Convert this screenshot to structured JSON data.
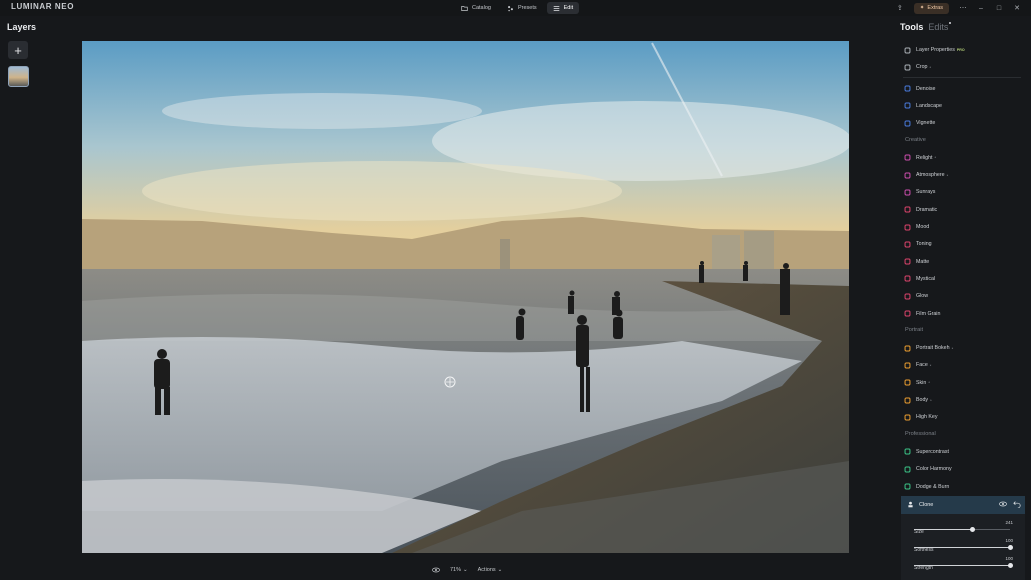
{
  "app": {
    "title": "LUMINAR NEO"
  },
  "modes": [
    {
      "label": "Catalog",
      "icon": "folder-icon"
    },
    {
      "label": "Presets",
      "icon": "presets-icon"
    },
    {
      "label": "Edit",
      "icon": "sliders-icon"
    }
  ],
  "top_right": {
    "extras_label": "Extras"
  },
  "layers": {
    "title": "Layers",
    "add": "+"
  },
  "bottom": {
    "zoom": "71%",
    "actions": "Actions"
  },
  "panel": {
    "tab_tools": "Tools",
    "tab_edits": "Edits",
    "essentials": [
      {
        "label": "Layer Properties",
        "badge": "PRO",
        "icon": "layers-icon",
        "color": "#aeb3ba"
      },
      {
        "label": "Crop",
        "badge": "*",
        "icon": "crop-icon",
        "color": "#aeb3ba"
      },
      {
        "label": "Denoise",
        "icon": "denoise-icon",
        "color": "#4a7de0"
      },
      {
        "label": "Landscape",
        "icon": "landscape-icon",
        "color": "#4a7de0"
      },
      {
        "label": "Vignette",
        "icon": "vignette-icon",
        "color": "#4a7de0"
      }
    ],
    "creative_title": "Creative",
    "creative": [
      {
        "label": "Relight",
        "badge": "*",
        "icon": "relight-icon",
        "color": "#d04fb0"
      },
      {
        "label": "Atmosphere",
        "badge": "*",
        "icon": "atmosphere-icon",
        "color": "#d04fb0"
      },
      {
        "label": "Sunrays",
        "icon": "sunrays-icon",
        "color": "#d04fb0"
      },
      {
        "label": "Dramatic",
        "icon": "dramatic-icon",
        "color": "#e0456e"
      },
      {
        "label": "Mood",
        "icon": "mood-icon",
        "color": "#e0456e"
      },
      {
        "label": "Toning",
        "icon": "toning-icon",
        "color": "#e0456e"
      },
      {
        "label": "Matte",
        "icon": "matte-icon",
        "color": "#e0456e"
      },
      {
        "label": "Mystical",
        "icon": "mystical-icon",
        "color": "#e0456e"
      },
      {
        "label": "Glow",
        "icon": "glow-icon",
        "color": "#e0456e"
      },
      {
        "label": "Film Grain",
        "icon": "film-grain-icon",
        "color": "#e0456e"
      }
    ],
    "portrait_title": "Portrait",
    "portrait": [
      {
        "label": "Portrait Bokeh",
        "badge": "*",
        "icon": "bokeh-icon",
        "color": "#f0a030"
      },
      {
        "label": "Face",
        "badge": "*",
        "icon": "face-icon",
        "color": "#f0a030"
      },
      {
        "label": "Skin",
        "badge": "*",
        "icon": "skin-icon",
        "color": "#f0a030"
      },
      {
        "label": "Body",
        "badge": "*",
        "icon": "body-icon",
        "color": "#f0a030"
      },
      {
        "label": "High Key",
        "icon": "high-key-icon",
        "color": "#f0a030"
      }
    ],
    "professional_title": "Professional",
    "professional": [
      {
        "label": "Supercontrast",
        "icon": "supercontrast-icon",
        "color": "#3cc98a"
      },
      {
        "label": "Color Harmony",
        "icon": "color-harmony-icon",
        "color": "#3cc98a"
      },
      {
        "label": "Dodge & Burn",
        "icon": "dodge-burn-icon",
        "color": "#3cc98a"
      }
    ],
    "clone": {
      "label": "Clone",
      "sliders": [
        {
          "label": "Size",
          "value": "241",
          "fraction": 0.61
        },
        {
          "label": "Softness",
          "value": "100",
          "fraction": 1.0
        },
        {
          "label": "Strength",
          "value": "100",
          "fraction": 1.0
        }
      ]
    }
  }
}
